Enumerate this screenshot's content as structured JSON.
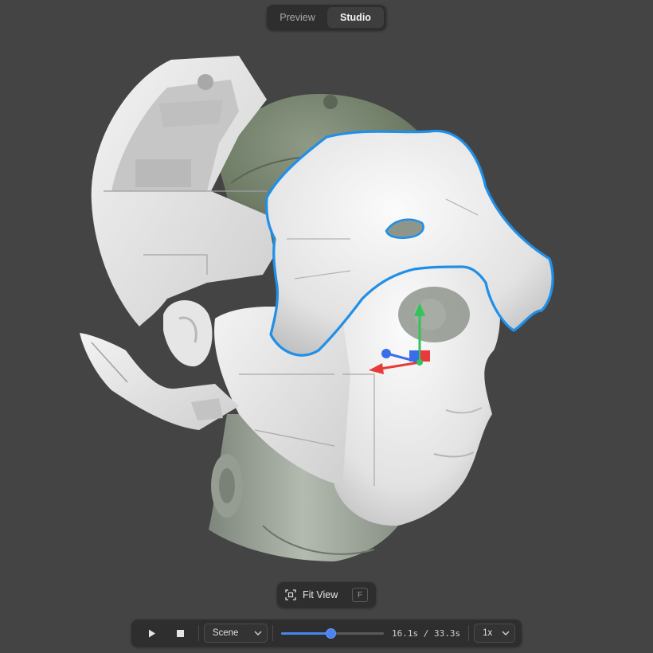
{
  "modes": {
    "preview_label": "Preview",
    "studio_label": "Studio",
    "active": "Studio"
  },
  "fit_view": {
    "label": "Fit View",
    "shortcut": "F",
    "icon": "focus-frame-icon"
  },
  "playback": {
    "play_icon": "play-icon",
    "stop_icon": "stop-icon",
    "scene_select": "Scene",
    "progress": 0.4835,
    "timecode": "16.1s / 33.3s",
    "speed_select": "1x"
  },
  "colors": {
    "background": "#444444",
    "selection_outline": "#1f8fe8",
    "accent": "#4a84f0",
    "gizmo_x": "#e83a3a",
    "gizmo_y": "#33c35a",
    "gizmo_z": "#3a6ee8",
    "helmet_green": "#6f7c66"
  }
}
